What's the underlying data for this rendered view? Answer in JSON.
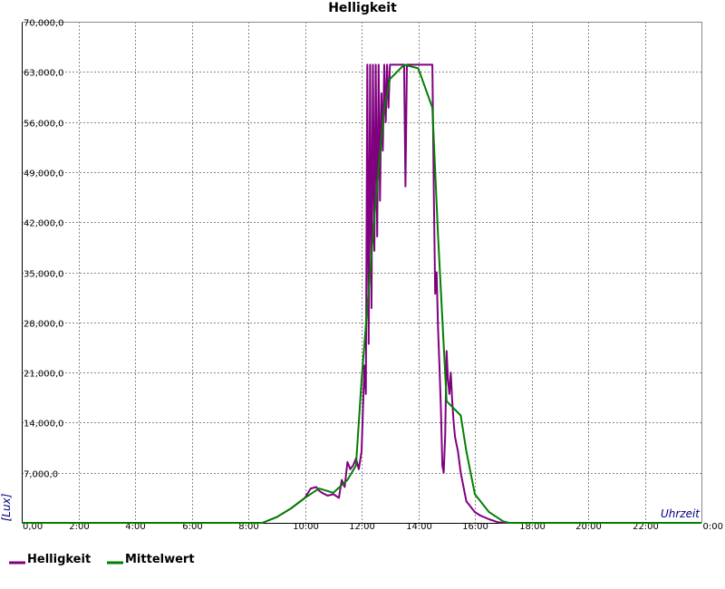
{
  "chart_data": {
    "type": "line",
    "title": "Helligkeit",
    "xlabel": "Uhrzeit",
    "ylabel": "[Lux]",
    "xlim": [
      0,
      24
    ],
    "ylim": [
      0,
      70000
    ],
    "x_ticks": [
      "0,00",
      "2:00",
      "4:00",
      "6:00",
      "8:00",
      "10:00",
      "12:00",
      "14:00",
      "16:00",
      "18:00",
      "20:00",
      "22:00",
      "0:00"
    ],
    "y_ticks": [
      "7,000,0",
      "14,000,0",
      "21,000,0",
      "28,000,0",
      "35,000,0",
      "42,000,0",
      "49,000,0",
      "56,000,0",
      "63,000,0",
      "70,000,0"
    ],
    "grid": true,
    "legend_position": "bottom-left",
    "series": [
      {
        "name": "Helligkeit",
        "color": "#800080",
        "x": [
          0,
          8.5,
          9.0,
          9.5,
          10.0,
          10.2,
          10.4,
          10.5,
          10.6,
          10.7,
          10.8,
          11.0,
          11.2,
          11.3,
          11.4,
          11.5,
          11.6,
          11.7,
          11.8,
          11.9,
          12.0,
          12.1,
          12.15,
          12.2,
          12.25,
          12.3,
          12.35,
          12.4,
          12.45,
          12.5,
          12.55,
          12.6,
          12.65,
          12.7,
          12.75,
          12.8,
          12.85,
          12.9,
          12.95,
          13.0,
          13.1,
          13.2,
          13.3,
          13.4,
          13.5,
          13.55,
          13.6,
          13.65,
          13.7,
          13.8,
          14.0,
          14.2,
          14.4,
          14.5,
          14.55,
          14.6,
          14.65,
          14.7,
          14.75,
          14.8,
          14.85,
          14.9,
          14.95,
          15.0,
          15.05,
          15.1,
          15.15,
          15.2,
          15.25,
          15.3,
          15.4,
          15.5,
          15.6,
          15.7,
          15.8,
          15.9,
          16.0,
          16.2,
          16.5,
          16.8,
          17.0,
          17.2,
          24
        ],
        "y": [
          0,
          0,
          800,
          2000,
          3500,
          4800,
          5000,
          4500,
          4200,
          4000,
          3800,
          4000,
          3500,
          6000,
          5000,
          8500,
          7500,
          8000,
          9000,
          7500,
          10000,
          22000,
          18000,
          64000,
          25000,
          64000,
          30000,
          64000,
          38000,
          64000,
          40000,
          64000,
          45000,
          60000,
          52000,
          64000,
          56000,
          64000,
          58000,
          64000,
          64000,
          64000,
          64000,
          64000,
          64000,
          47000,
          64000,
          64000,
          64000,
          64000,
          64000,
          64000,
          64000,
          64000,
          46000,
          32000,
          35000,
          27000,
          22000,
          16000,
          8000,
          7000,
          12000,
          24000,
          20000,
          18000,
          21000,
          17000,
          14000,
          12000,
          10000,
          7000,
          5000,
          3000,
          2500,
          2000,
          1500,
          1000,
          500,
          100,
          0,
          0,
          0
        ]
      },
      {
        "name": "Mittelwert",
        "color": "#008000",
        "x": [
          0,
          8.5,
          9.0,
          9.5,
          10.0,
          10.5,
          11.0,
          11.5,
          11.8,
          12.0,
          12.5,
          12.8,
          13.0,
          13.5,
          14.0,
          14.5,
          14.7,
          15.0,
          15.5,
          15.7,
          16.0,
          16.5,
          17.0,
          17.2,
          24
        ],
        "y": [
          0,
          0,
          800,
          2000,
          3500,
          4800,
          4200,
          6000,
          8000,
          20000,
          45000,
          58000,
          62000,
          64000,
          63500,
          58000,
          40000,
          17000,
          15000,
          10000,
          4000,
          1500,
          200,
          0,
          0
        ]
      }
    ]
  }
}
